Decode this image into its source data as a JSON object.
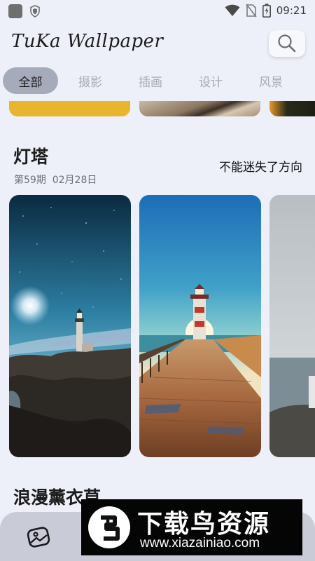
{
  "status_bar": {
    "time": "09:21"
  },
  "header": {
    "app_title": "TuKa Wallpaper"
  },
  "tabs": [
    {
      "label": "全部",
      "active": true
    },
    {
      "label": "摄影",
      "active": false
    },
    {
      "label": "插画",
      "active": false
    },
    {
      "label": "设计",
      "active": false
    },
    {
      "label": "风景",
      "active": false
    }
  ],
  "section": {
    "title": "灯塔",
    "issue": "第59期",
    "date": "02月28日",
    "subtitle": "不能迷失了方向"
  },
  "next_section": {
    "title": "浪漫薰衣草"
  },
  "watermark": {
    "title": "下载鸟资源",
    "url": "www.xiazainiao.com"
  },
  "colors": {
    "background": "#eef0f9",
    "active_tab": "#a6abbb",
    "bottom_nav": "#c9ccd6"
  },
  "icons": [
    "app-icon",
    "shield-icon",
    "wifi-icon",
    "no-sim-icon",
    "battery-icon",
    "search-icon",
    "gallery-icon",
    "bird-logo"
  ]
}
